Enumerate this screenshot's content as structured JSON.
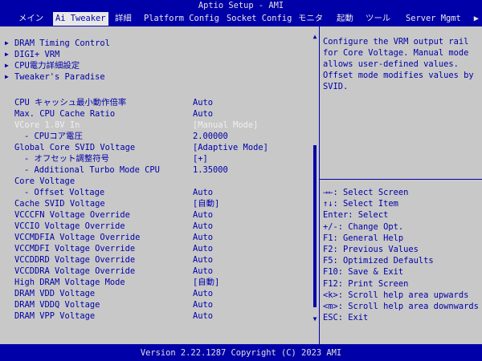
{
  "window": {
    "title": "Aptio Setup - AMI"
  },
  "tabs": [
    {
      "label": "メイン"
    },
    {
      "label": "Ai Tweaker"
    },
    {
      "label": "詳細"
    },
    {
      "label": "Platform Config"
    },
    {
      "label": "Socket Config"
    },
    {
      "label": "モニタ"
    },
    {
      "label": "起動"
    },
    {
      "label": "ツール"
    },
    {
      "label": "Server Mgmt"
    }
  ],
  "tab_more": "▶",
  "settings": [
    {
      "label": "DRAM Timing Control",
      "value": "",
      "submenu": true
    },
    {
      "label": "DIGI+ VRM",
      "value": "",
      "submenu": true
    },
    {
      "label": "CPU電力詳細設定",
      "value": "",
      "submenu": true
    },
    {
      "label": "Tweaker's Paradise",
      "value": "",
      "submenu": true
    },
    {
      "label": "CPU キャッシュ最小動作倍率",
      "value": "Auto"
    },
    {
      "label": "Max. CPU Cache Ratio",
      "value": "Auto"
    },
    {
      "label": "VCore 1.8V In",
      "value": "[Manual Mode]",
      "highlight": true
    },
    {
      "label": "- CPUコア電圧",
      "value": "2.00000",
      "indent": true
    },
    {
      "label": "Global Core SVID Voltage",
      "value": "[Adaptive Mode]"
    },
    {
      "label": "- オフセット調整符号",
      "value": "[+]",
      "indent": true
    },
    {
      "label": "- Additional Turbo Mode CPU",
      "value": "1.35000",
      "indent": true
    },
    {
      "label": "Core Voltage",
      "value": ""
    },
    {
      "label": "- Offset Voltage",
      "value": "Auto",
      "indent": true
    },
    {
      "label": "Cache SVID Voltage",
      "value": "[自動]"
    },
    {
      "label": "VCCCFN Voltage Override",
      "value": "Auto"
    },
    {
      "label": "VCCIO Voltage Override",
      "value": "Auto"
    },
    {
      "label": "VCCMDFIA Voltage Override",
      "value": "Auto"
    },
    {
      "label": "VCCMDFI Voltage Override",
      "value": "Auto"
    },
    {
      "label": "VCCDDRD Voltage Override",
      "value": "Auto"
    },
    {
      "label": "VCCDDRA Voltage Override",
      "value": "Auto"
    },
    {
      "label": "High DRAM Voltage Mode",
      "value": "[自動]"
    },
    {
      "label": "DRAM VDD Voltage",
      "value": "Auto"
    },
    {
      "label": "DRAM VDDQ Voltage",
      "value": "Auto"
    },
    {
      "label": "DRAM VPP Voltage",
      "value": "Auto"
    }
  ],
  "help": {
    "text": "Configure the VRM output rail for Core Voltage. Manual mode allows user-defined values. Offset mode modifies values by SVID."
  },
  "keys": [
    "→←: Select Screen",
    "↑↓: Select Item",
    "Enter: Select",
    "+/-: Change Opt.",
    "F1: General Help",
    "F2: Previous Values",
    "F5: Optimized Defaults",
    "F10: Save & Exit",
    "F12: Print Screen",
    "<k>: Scroll help area upwards",
    "<m>: Scroll help area downwards",
    "ESC: Exit"
  ],
  "footer": {
    "text": "Version 2.22.1287 Copyright (C) 2023 AMI"
  },
  "colors": {
    "background": "#0000a8",
    "panel": "#c8c8c8",
    "text": "#0000a8",
    "highlight": "#f0f0f0"
  }
}
